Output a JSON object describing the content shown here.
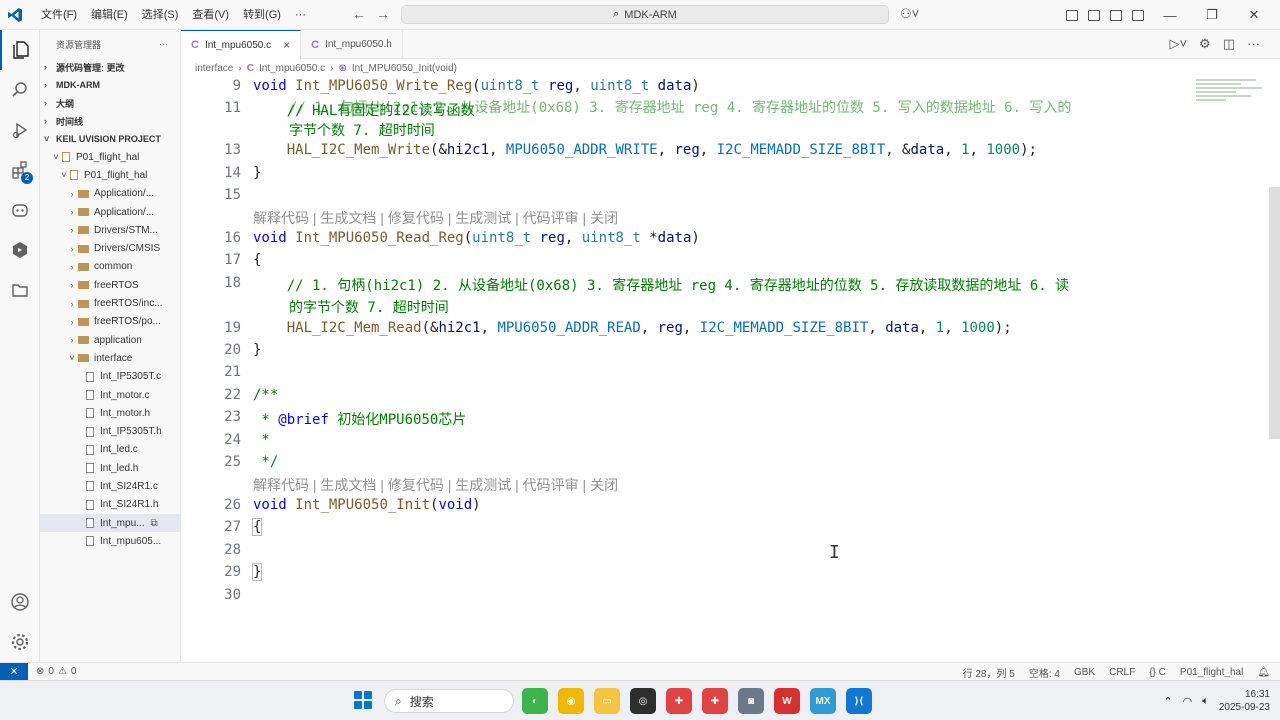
{
  "titlebar": {
    "menu": [
      "文件(F)",
      "编辑(E)",
      "选择(S)",
      "查看(V)",
      "转到(G)",
      "···"
    ],
    "search": "MDK-ARM"
  },
  "activity": {
    "extensions_badge": "2"
  },
  "sidebar": {
    "title": "资源管理器",
    "more": "···",
    "sections": [
      "源代码管理: 更改",
      "MDK-ARM",
      "大纲",
      "时间线",
      "KEIL UVISION PROJECT"
    ],
    "tree": [
      {
        "label": "P01_flight_hal",
        "indent": 1,
        "kind": "open"
      },
      {
        "label": "P01_flight_hal",
        "indent": 2,
        "kind": "open"
      },
      {
        "label": "Application/...",
        "indent": 3,
        "kind": "folder"
      },
      {
        "label": "Application/...",
        "indent": 3,
        "kind": "folder"
      },
      {
        "label": "Drivers/STM...",
        "indent": 3,
        "kind": "folder"
      },
      {
        "label": "Drivers/CMSIS",
        "indent": 3,
        "kind": "folder"
      },
      {
        "label": "common",
        "indent": 3,
        "kind": "folder"
      },
      {
        "label": "freeRTOS",
        "indent": 3,
        "kind": "folder"
      },
      {
        "label": "freeRTOS/inc...",
        "indent": 3,
        "kind": "folder"
      },
      {
        "label": "freeRTOS/po...",
        "indent": 3,
        "kind": "folder"
      },
      {
        "label": "application",
        "indent": 3,
        "kind": "folder"
      },
      {
        "label": "interface",
        "indent": 3,
        "kind": "folder-open"
      },
      {
        "label": "Int_IP5305T.c",
        "indent": 4,
        "kind": "file"
      },
      {
        "label": "Int_motor.c",
        "indent": 4,
        "kind": "file"
      },
      {
        "label": "Int_motor.h",
        "indent": 4,
        "kind": "file"
      },
      {
        "label": "Int_IP5305T.h",
        "indent": 4,
        "kind": "file"
      },
      {
        "label": "Int_led.c",
        "indent": 4,
        "kind": "file"
      },
      {
        "label": "Int_led.h",
        "indent": 4,
        "kind": "file"
      },
      {
        "label": "Int_SI24R1.c",
        "indent": 4,
        "kind": "file"
      },
      {
        "label": "Int_SI24R1.h",
        "indent": 4,
        "kind": "file"
      },
      {
        "label": "Int_mpu...",
        "indent": 4,
        "kind": "file",
        "selected": true
      },
      {
        "label": "Int_mpu605...",
        "indent": 4,
        "kind": "file"
      }
    ]
  },
  "tabs": [
    {
      "label": "Int_mpu6050.c",
      "active": true
    },
    {
      "label": "Int_mpu6050.h",
      "active": false
    }
  ],
  "breadcrumb": [
    "interface",
    "Int_mpu6050.c",
    "Int_MPU6050_Init(void)"
  ],
  "editor": {
    "codelens": "解释代码 | 生成文档 | 修复代码 | 生成测试 | 代码评审 | 关闭",
    "lines": {
      "l9": "9",
      "l11": "11",
      "l13": "13",
      "l14": "14",
      "l15": "15",
      "l16": "16",
      "l17": "17",
      "l18": "18",
      "l19": "19",
      "l20": "20",
      "l21": "21",
      "l22": "22",
      "l23": "23",
      "l24": "24",
      "l25": "25",
      "l26": "26",
      "l27": "27",
      "l28": "28",
      "l29": "29",
      "l30": "30"
    },
    "code": {
      "write_sig_fn": "Int_MPU6050_Write_Reg",
      "read_sig_fn": "Int_MPU6050_Read_Reg",
      "init_sig_fn": "Int_MPU6050_Init",
      "comment_hal": "// HAL有固定的I2C读写函数",
      "comment_write_a": "// 1. 句柄(hi2c1) 2. 从设备地址(0x68) 3. 寄存器地址 reg 4. 寄存器地址的位数 5. 写入的数据地址 6. 写入的",
      "comment_write_b": "字节个数 7. 超时时间",
      "comment_read_a": "// 1. 句柄(hi2c1) 2. 从设备地址(0x68) 3. 寄存器地址 reg 4. 寄存器地址的位数 5. 存放读取数据的地址 6. 读",
      "comment_read_b": "的字节个数 7. 超时时间",
      "write_call_fn": "HAL_I2C_Mem_Write",
      "read_call_fn": "HAL_I2C_Mem_Read",
      "addr_write": "MPU6050_ADDR_WRITE",
      "addr_read": "MPU6050_ADDR_READ",
      "memadd": "I2C_MEMADD_SIZE_8BIT",
      "doc_open": "/**",
      "doc_brief_tag": "@brief",
      "doc_brief_text": "初始化MPU6050芯片",
      "doc_star": " *",
      "doc_close": " */"
    }
  },
  "statusbar": {
    "problems": "0",
    "warnings": "0",
    "position": "行 28，列 5",
    "spaces": "空格: 4",
    "encoding": "GBK",
    "eol": "CRLF",
    "language": "{} C",
    "project": "P01_flight_hal"
  },
  "taskbar": {
    "search": "搜索",
    "time": "16:31",
    "date": "2025-09-23"
  }
}
